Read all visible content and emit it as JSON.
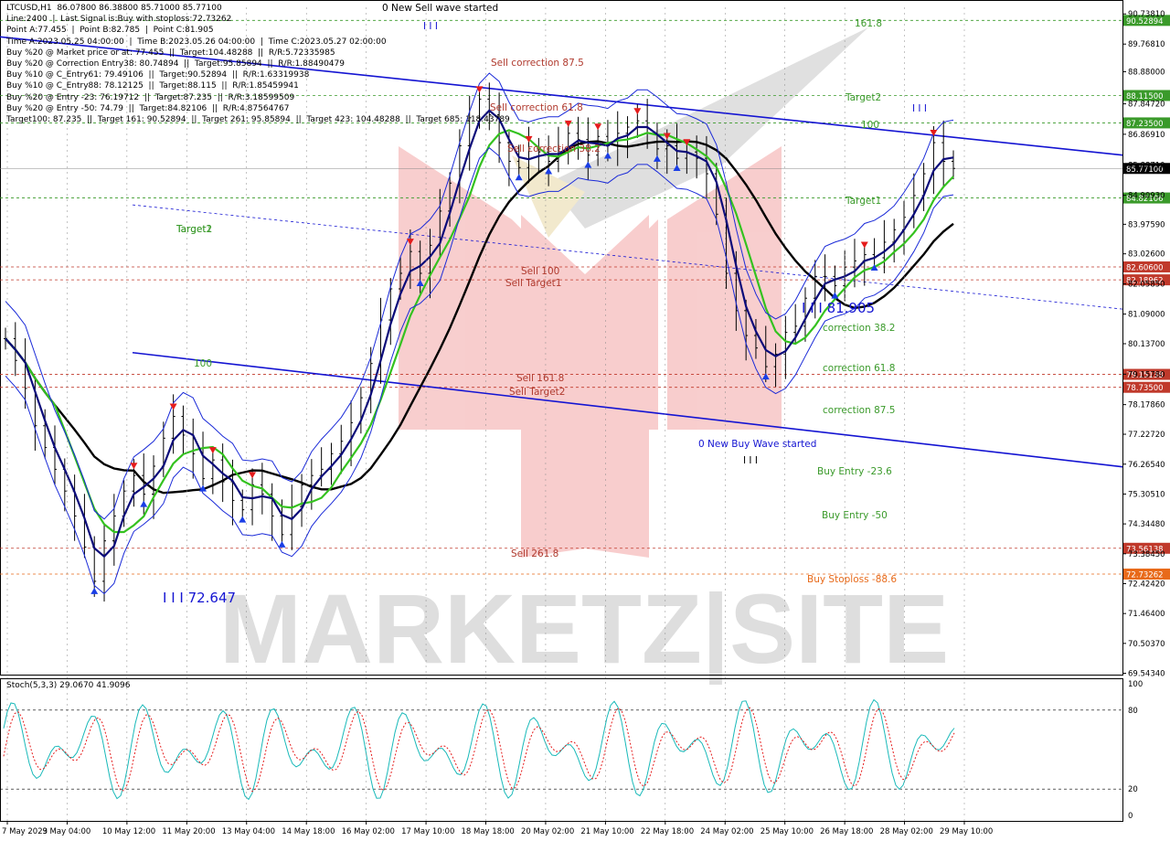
{
  "header": {
    "lines": [
      "LTCUSD,H1  86.07800 86.38800 85.71000 85.77100",
      "Line:2400  |  Last Signal is:Buy with stoploss:72.73262",
      "Point A:77.455  |  Point B:82.785  |  Point C:81.905",
      "Time A:2023.05.25 04:00:00  |  Time B:2023.05.26 04:00:00  |  Time C:2023.05.27 02:00:00",
      "Buy %20 @ Market price or at: 77.455  ||  Target:104.48288  ||  R/R:5.72335985",
      "Buy %20 @ Correction Entry38: 80.74894  ||  Target:95.85894  ||  R/R:1.88490479",
      "Buy %10 @ C_Entry61: 79.49106  ||  Target:90.52894  ||  R/R:1.63319938",
      "Buy %10 @ C_Entry88: 78.12125  ||  Target:88.115  ||  R/R:1.85459941",
      "Buy %20 @ Entry -23: 76.19712  ||  Target:87.235  ||  R/R:3.18599509",
      "Buy %20 @ Entry -50: 74.79  ||  Target:84.82106  ||  R/R:4.87564767",
      "Target100: 87.235  ||  Target 161: 90.52894  ||  Target 261: 95.85894  ||  Target 423: 104.48288  ||  Target 685: 118.43789"
    ]
  },
  "chart_data": {
    "type": "candlestick",
    "symbol": "LTCUSD,H1",
    "ohlc": {
      "open": 86.078,
      "high": 86.388,
      "low": 85.71,
      "close": 85.771
    },
    "ylim": [
      69.5,
      90.95
    ],
    "y_ticks": [
      90.7381,
      89.7681,
      88.88,
      87.8472,
      86.8691,
      85.8871,
      84.9093,
      83.9759,
      83.026,
      82.0585,
      81.09,
      80.137,
      79.1578,
      78.1786,
      77.2272,
      76.2654,
      75.3051,
      74.3448,
      73.3845,
      72.4242,
      71.464,
      70.5037,
      69.5434
    ],
    "y_tick_labels": [
      "90.73810",
      "89.76810",
      "88.88000",
      "87.84720",
      "86.86910",
      "85.88710",
      "84.90930",
      "83.97590",
      "83.02600",
      "82.05850",
      "81.09000",
      "80.13700",
      "79.15780",
      "78.17860",
      "77.22720",
      "76.26540",
      "75.30510",
      "74.34480",
      "73.38450",
      "72.42420",
      "71.46400",
      "70.50370",
      "69.54340"
    ],
    "x_tick_labels": [
      "7 May 2023",
      "9 May 04:00",
      "10 May 12:00",
      "11 May 20:00",
      "13 May 04:00",
      "14 May 18:00",
      "16 May 02:00",
      "17 May 10:00",
      "18 May 18:00",
      "20 May 02:00",
      "21 May 10:00",
      "22 May 18:00",
      "24 May 02:00",
      "25 May 10:00",
      "26 May 18:00",
      "28 May 02:00",
      "29 May 10:00"
    ],
    "price_levels": [
      {
        "value": 90.52894,
        "label": "90.52894",
        "color": "#3a9a2a"
      },
      {
        "value": 88.115,
        "label": "88.11500",
        "color": "#3a9a2a"
      },
      {
        "value": 87.235,
        "label": "87.23500",
        "color": "#3a9a2a"
      },
      {
        "value": 84.82106,
        "label": "84.82106",
        "color": "#3a9a2a"
      },
      {
        "value": 82.606,
        "label": "82.60600",
        "color": "#c0392b"
      },
      {
        "value": 82.18962,
        "label": "82.18962",
        "color": "#c0392b"
      },
      {
        "value": 79.15138,
        "label": "79.15138",
        "color": "#c0392b"
      },
      {
        "value": 78.735,
        "label": "78.73500",
        "color": "#c0392b"
      },
      {
        "value": 73.56138,
        "label": "73.56138",
        "color": "#c0392b"
      },
      {
        "value": 72.73262,
        "label": "72.73262",
        "color": "#e86a1a"
      }
    ],
    "current_price": {
      "value": 85.771,
      "label": "85.77100"
    },
    "close_series": [
      80.3,
      79.6,
      78.7,
      77.5,
      76.8,
      76.1,
      75.4,
      74.6,
      73.6,
      72.5,
      73.8,
      74.6,
      75.4,
      75.9,
      75.3,
      76.2,
      77.1,
      77.8,
      77.2,
      76.6,
      75.8,
      76.4,
      75.7,
      75.1,
      74.8,
      75.6,
      75.3,
      74.6,
      74.0,
      74.9,
      75.6,
      75.9,
      76.1,
      76.6,
      77.0,
      77.6,
      78.4,
      79.5,
      80.9,
      81.9,
      82.4,
      83.1,
      82.4,
      83.3,
      84.4,
      85.3,
      86.5,
      87.4,
      88.0,
      87.5,
      86.6,
      86.0,
      85.8,
      86.4,
      86.3,
      86.0,
      86.4,
      86.9,
      86.7,
      86.2,
      86.8,
      86.5,
      86.9,
      87.1,
      87.3,
      86.9,
      86.4,
      86.5,
      86.1,
      86.3,
      86.1,
      85.6,
      84.3,
      82.4,
      81.2,
      80.4,
      80.0,
      79.4,
      79.8,
      80.5,
      80.7,
      81.6,
      82.3,
      82.3,
      82.0,
      82.6,
      82.8,
      83.0,
      82.9,
      83.4,
      83.8,
      84.2,
      84.9,
      85.6,
      86.6,
      86.0,
      85.771
    ],
    "labels": {
      "fib_top": "161.8",
      "target2": "Target2",
      "level100": "100",
      "target1": "Target1",
      "target1_ghost": "Target1",
      "target2_ghost": "Target2",
      "sell_wave": "0 New Sell wave started",
      "buy_wave": "0 New Buy Wave started",
      "sell_correction_87": "Sell correction 87.5",
      "sell_correction_61": "Sell correction 61.8",
      "sell_correction_38": "Sell correction 38.2",
      "sell100": "Sell 100",
      "sell_target1": "Sell Target1",
      "sell161": "Sell 161.8",
      "sell_target2": "Sell Target2",
      "sell261": "Sell  261.8",
      "corr382": "correction 38.2",
      "corr618": "correction 61.8",
      "corr875": "correction 87.5",
      "buy_entry_236": "Buy Entry -23.6",
      "buy_entry_50": "Buy Entry -50",
      "buy_stoploss": "Buy Stoploss -88.6",
      "point_c": "I I I 81.905",
      "low_label": "I I I 72.647",
      "left_100": "100",
      "wave_iii_top": "I I I",
      "wave_iii_bottom": "I I I",
      "wave_iii_right": "I I I"
    },
    "stoch": {
      "title": "Stoch(5,3,3) 29.0670 41.9096",
      "ylim": [
        0,
        100
      ],
      "ticks": [
        100,
        80,
        20,
        0
      ],
      "levels": [
        80,
        20
      ]
    },
    "watermark": "MARKETZ|SITE",
    "colors": {
      "up_arrow": "#1a3ee6",
      "down_arrow": "#e51c1c",
      "trend_line": "#1414d2",
      "ma_black": "#000000",
      "ma_green": "#34c21f",
      "ma_navy": "#0b0b7a",
      "band_blue": "#1a2ad8",
      "green_text": "#3a9a2a",
      "red_text": "#b03a2e",
      "orange_text": "#e86a1a"
    }
  }
}
